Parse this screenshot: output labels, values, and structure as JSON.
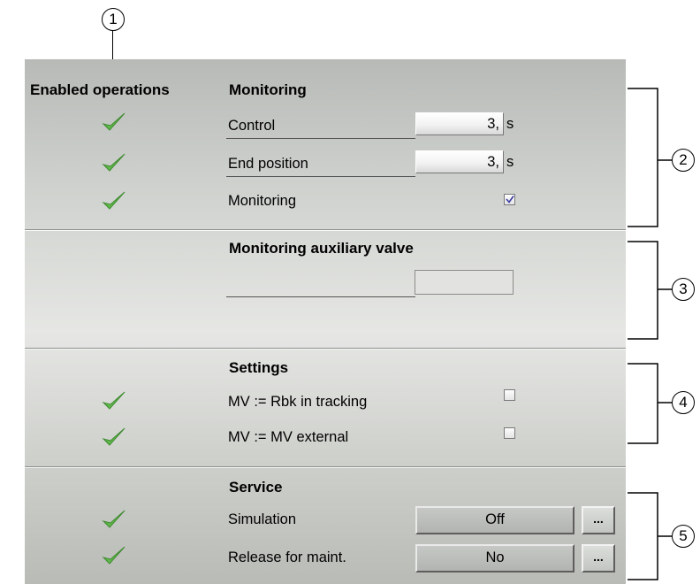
{
  "callouts": [
    "1",
    "2",
    "3",
    "4",
    "5"
  ],
  "headers": {
    "enabled_operations": "Enabled operations",
    "monitoring": "Monitoring",
    "monitoring_aux_valve": "Monitoring auxiliary valve",
    "settings": "Settings",
    "service": "Service"
  },
  "monitoring": {
    "control": {
      "label": "Control",
      "value": "3,",
      "unit": "s",
      "enabled": true
    },
    "end_position": {
      "label": "End position",
      "value": "3,",
      "unit": "s",
      "enabled": true
    },
    "monitoring": {
      "label": "Monitoring",
      "checked": true,
      "enabled": true
    }
  },
  "aux_valve": {
    "value": ""
  },
  "settings": {
    "mv_rbk": {
      "label": "MV := Rbk in tracking",
      "checked": false,
      "enabled": true
    },
    "mv_external": {
      "label": "MV := MV external",
      "checked": false,
      "enabled": true
    }
  },
  "service": {
    "simulation": {
      "label": "Simulation",
      "value": "Off",
      "more": "...",
      "enabled": true
    },
    "release": {
      "label": "Release for maint.",
      "value": "No",
      "more": "...",
      "enabled": true
    }
  },
  "colors": {
    "check": "#5fb84a",
    "panel": "#cfd2ce"
  },
  "icons": {
    "enabled": "checkmark-icon"
  }
}
